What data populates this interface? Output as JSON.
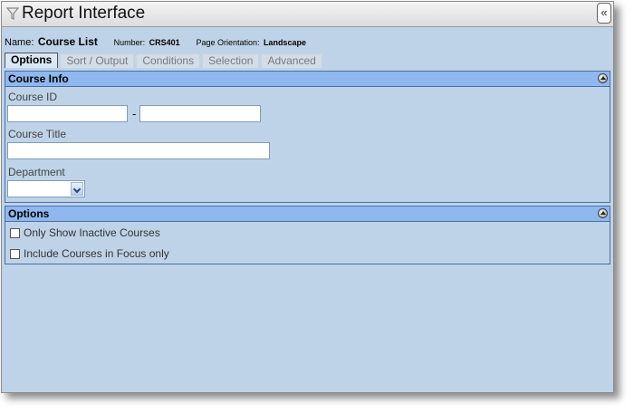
{
  "window": {
    "title": "Report Interface",
    "collapse_label": "«",
    "title_icon": "funnel-icon"
  },
  "report": {
    "name_label": "Name:",
    "name_value": "Course List",
    "number_label": "Number:",
    "number_value": "CRS401",
    "orientation_label": "Page Orientation:",
    "orientation_value": "Landscape"
  },
  "tabs": [
    {
      "label": "Options",
      "active": true
    },
    {
      "label": "Sort / Output",
      "active": false
    },
    {
      "label": "Conditions",
      "active": false
    },
    {
      "label": "Selection",
      "active": false
    },
    {
      "label": "Advanced",
      "active": false
    }
  ],
  "course_info": {
    "header": "Course Info",
    "course_id_label": "Course ID",
    "course_id_from": "",
    "course_id_separator": "-",
    "course_id_to": "",
    "course_title_label": "Course Title",
    "course_title_value": "",
    "department_label": "Department",
    "department_value": ""
  },
  "options": {
    "header": "Options",
    "items": [
      {
        "label": "Only Show Inactive Courses",
        "checked": false
      },
      {
        "label": "Include Courses in Focus only",
        "checked": false
      }
    ]
  },
  "colors": {
    "background": "#bfd3e8",
    "panel_header": "#8fb8ef",
    "panel_border": "#4a6fa5"
  }
}
